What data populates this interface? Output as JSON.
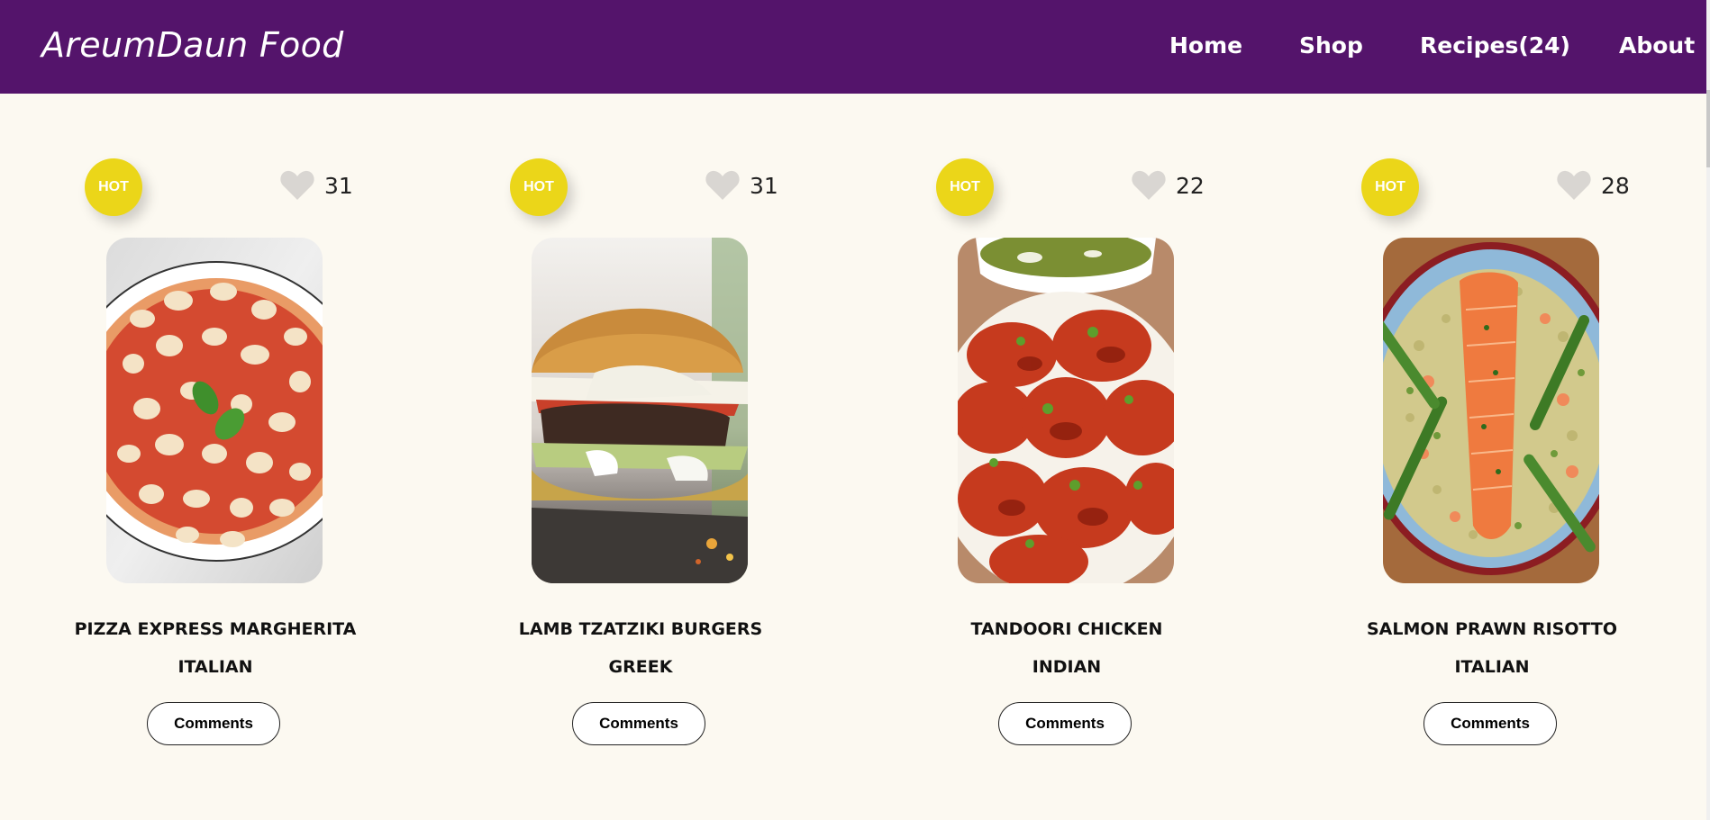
{
  "header": {
    "brand": "AreumDaun Food",
    "nav": [
      {
        "label": "Home"
      },
      {
        "label": "Shop"
      },
      {
        "label": "Recipes(24)"
      },
      {
        "label": "About"
      }
    ]
  },
  "colors": {
    "nav_bg": "#54146b",
    "page_bg": "#fcf9f1",
    "hot_badge": "#ebd619",
    "heart": "#d9d6d2"
  },
  "recipes": [
    {
      "badge": "HOT",
      "likes": "31",
      "title": "PIZZA EXPRESS MARGHERITA",
      "cuisine": "ITALIAN",
      "button": "Comments",
      "icon": "heart-icon"
    },
    {
      "badge": "HOT",
      "likes": "31",
      "title": "LAMB TZATZIKI BURGERS",
      "cuisine": "GREEK",
      "button": "Comments",
      "icon": "heart-icon"
    },
    {
      "badge": "HOT",
      "likes": "22",
      "title": "TANDOORI CHICKEN",
      "cuisine": "INDIAN",
      "button": "Comments",
      "icon": "heart-icon"
    },
    {
      "badge": "HOT",
      "likes": "28",
      "title": "SALMON PRAWN RISOTTO",
      "cuisine": "ITALIAN",
      "button": "Comments",
      "icon": "heart-icon"
    }
  ]
}
